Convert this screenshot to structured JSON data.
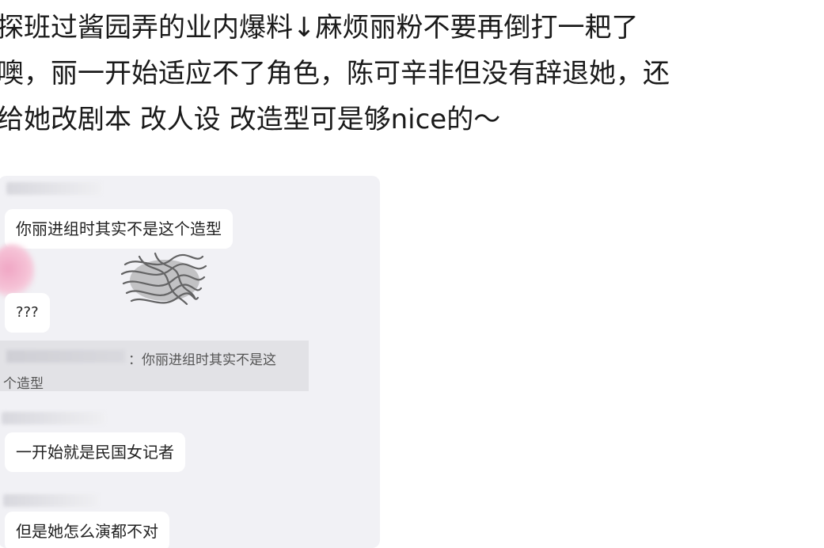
{
  "post": {
    "lines": [
      "探班过酱园弄的业内爆料↓麻烦丽粉不要再倒打一耙了",
      "噢，丽一开始适应不了角色，陈可辛非但没有辞退她，还",
      "给她改剧本 改人设 改造型可是够nice的～"
    ]
  },
  "chat": {
    "messages": [
      "你丽进组时其实不是这个造型",
      "???",
      "一开始就是民国女记者",
      "但是她怎么演都不对"
    ],
    "quote": {
      "separator": "：",
      "line1": "你丽进组时其实不是这",
      "line2": "个造型"
    },
    "icons": {
      "sticker": "scribble-sticker-icon",
      "blurred_avatar": "pink-blur-icon"
    },
    "colors": {
      "background": "#f1f1f5",
      "bubble": "#ffffff",
      "quote": "#e2e2e6"
    }
  }
}
